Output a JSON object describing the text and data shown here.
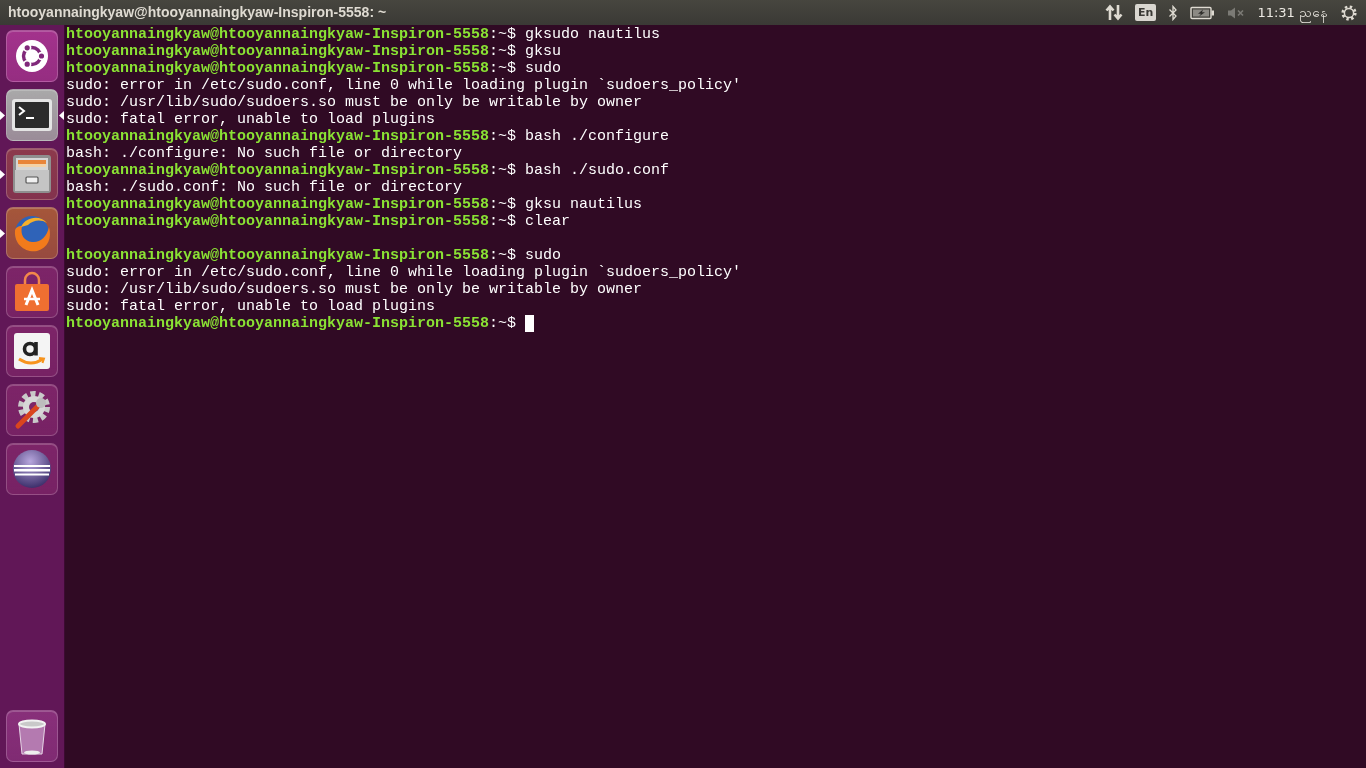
{
  "top_bar": {
    "window_title": "htooyannaingkyaw@htooyannaingkyaw-Inspiron-5558: ~",
    "indicators": [
      {
        "kind": "network"
      },
      {
        "kind": "keyboard",
        "label": "En"
      },
      {
        "kind": "bluetooth"
      },
      {
        "kind": "battery",
        "charging": true
      },
      {
        "kind": "volume",
        "muted": true
      },
      {
        "kind": "clock",
        "label": "11:31 ညနေ"
      },
      {
        "kind": "session"
      }
    ]
  },
  "launcher": {
    "items": [
      {
        "kind": "dash",
        "running": false,
        "focused": false
      },
      {
        "kind": "terminal",
        "running": true,
        "focused": true
      },
      {
        "kind": "files",
        "running": true,
        "focused": false
      },
      {
        "kind": "browser",
        "running": true,
        "focused": false
      },
      {
        "kind": "software-center",
        "running": false,
        "focused": false
      },
      {
        "kind": "amazon",
        "running": false,
        "focused": false
      },
      {
        "kind": "settings",
        "running": false,
        "focused": false
      },
      {
        "kind": "eclipse",
        "running": false,
        "focused": false
      },
      {
        "kind": "trash",
        "running": false,
        "focused": false
      }
    ]
  },
  "terminal": {
    "lines": [
      {
        "kind": "prompt",
        "prompt": "htooyannaingkyaw@htooyannaingkyaw-Inspiron-5558",
        "suffix": ":~$",
        "command": "gksudo nautilus",
        "cursor": false
      },
      {
        "kind": "prompt",
        "prompt": "htooyannaingkyaw@htooyannaingkyaw-Inspiron-5558",
        "suffix": ":~$",
        "command": "gksu",
        "cursor": false
      },
      {
        "kind": "prompt",
        "prompt": "htooyannaingkyaw@htooyannaingkyaw-Inspiron-5558",
        "suffix": ":~$",
        "command": "sudo",
        "cursor": false
      },
      {
        "kind": "output",
        "text": "sudo: error in /etc/sudo.conf, line 0 while loading plugin `sudoers_policy'"
      },
      {
        "kind": "output",
        "text": "sudo: /usr/lib/sudo/sudoers.so must be only be writable by owner"
      },
      {
        "kind": "output",
        "text": "sudo: fatal error, unable to load plugins"
      },
      {
        "kind": "prompt",
        "prompt": "htooyannaingkyaw@htooyannaingkyaw-Inspiron-5558",
        "suffix": ":~$",
        "command": "bash ./configure",
        "cursor": false
      },
      {
        "kind": "output",
        "text": "bash: ./configure: No such file or directory"
      },
      {
        "kind": "prompt",
        "prompt": "htooyannaingkyaw@htooyannaingkyaw-Inspiron-5558",
        "suffix": ":~$",
        "command": "bash ./sudo.conf",
        "cursor": false
      },
      {
        "kind": "output",
        "text": "bash: ./sudo.conf: No such file or directory"
      },
      {
        "kind": "prompt",
        "prompt": "htooyannaingkyaw@htooyannaingkyaw-Inspiron-5558",
        "suffix": ":~$",
        "command": "gksu nautilus",
        "cursor": false
      },
      {
        "kind": "prompt",
        "prompt": "htooyannaingkyaw@htooyannaingkyaw-Inspiron-5558",
        "suffix": ":~$",
        "command": "clear",
        "cursor": false
      },
      {
        "kind": "blank"
      },
      {
        "kind": "prompt",
        "prompt": "htooyannaingkyaw@htooyannaingkyaw-Inspiron-5558",
        "suffix": ":~$",
        "command": "sudo",
        "cursor": false
      },
      {
        "kind": "output",
        "text": "sudo: error in /etc/sudo.conf, line 0 while loading plugin `sudoers_policy'"
      },
      {
        "kind": "output",
        "text": "sudo: /usr/lib/sudo/sudoers.so must be only be writable by owner"
      },
      {
        "kind": "output",
        "text": "sudo: fatal error, unable to load plugins"
      },
      {
        "kind": "prompt",
        "prompt": "htooyannaingkyaw@htooyannaingkyaw-Inspiron-5558",
        "suffix": ":~$",
        "cursor": true
      }
    ]
  }
}
